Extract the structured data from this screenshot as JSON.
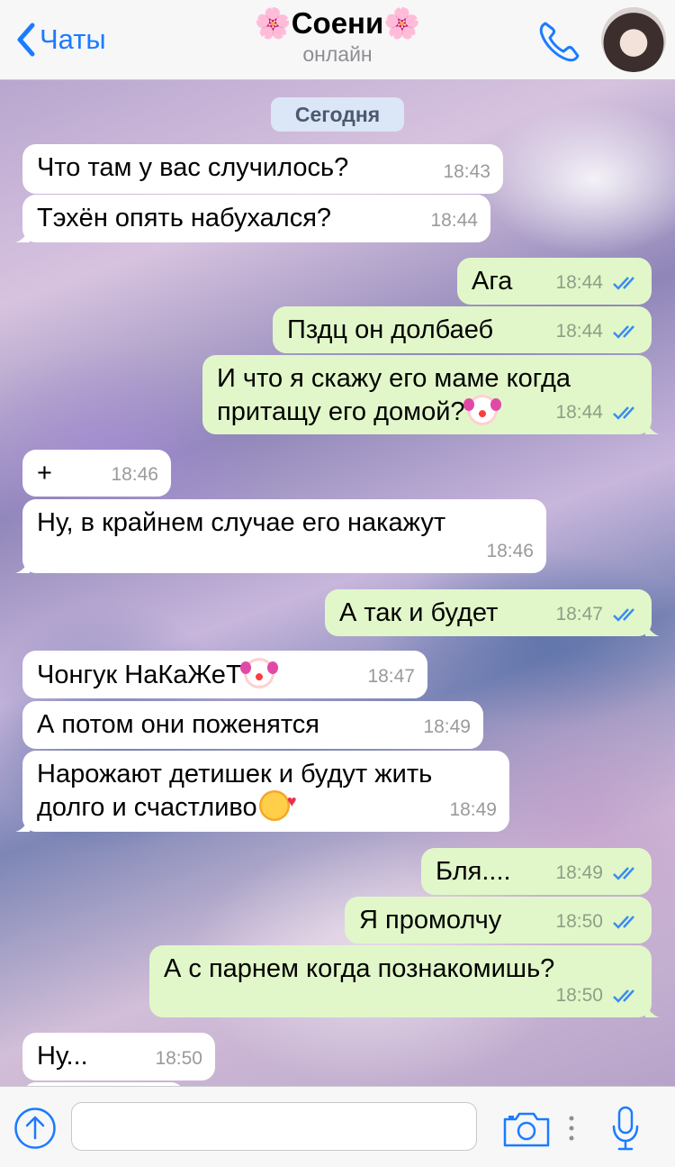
{
  "header": {
    "back_label": "Чаты",
    "title": "🌸Соени🌸",
    "subtitle": "онлайн"
  },
  "chat": {
    "date_label": "Сегодня",
    "messages": [
      {
        "dir": "in",
        "text": "Что там у вас случилось?",
        "time": "18:43"
      },
      {
        "dir": "in",
        "text": "Тэхён опять набухался?",
        "time": "18:44"
      },
      {
        "dir": "out",
        "text": "Ага",
        "time": "18:44"
      },
      {
        "dir": "out",
        "text": "Пздц он долбаеб",
        "time": "18:44"
      },
      {
        "dir": "out",
        "text": "И что я скажу его маме когда\nпритащу его домой?",
        "emoji": "clown-face",
        "time": "18:44"
      },
      {
        "dir": "in",
        "text": "+",
        "time": "18:46"
      },
      {
        "dir": "in",
        "text": "Ну, в крайнем случае его накажут",
        "time": "18:46"
      },
      {
        "dir": "out",
        "text": "А так и будет",
        "time": "18:47"
      },
      {
        "dir": "in",
        "text": "Чонгук НаКаЖеТ",
        "emoji": "clown-face",
        "time": "18:47"
      },
      {
        "dir": "in",
        "text": "А потом они поженятся",
        "time": "18:49"
      },
      {
        "dir": "in",
        "text": "Нарожают детишек и будут жить\nдолго и счастливо",
        "emoji": "smiling-face-with-hearts",
        "time": "18:49"
      },
      {
        "dir": "out",
        "text": "Бля....",
        "time": "18:49"
      },
      {
        "dir": "out",
        "text": "Я промолчу",
        "time": "18:50"
      },
      {
        "dir": "out",
        "text": "А с парнем когда познакомишь?",
        "time": "18:50"
      },
      {
        "dir": "in",
        "text": "Ну...",
        "time": "18:50"
      }
    ]
  },
  "input": {
    "value": "",
    "placeholder": ""
  },
  "colors": {
    "accent": "#1a7cff",
    "incoming_bubble": "#ffffff",
    "outgoing_bubble": "#e1f7c9",
    "read_ticks": "#3b8cf0"
  },
  "icons": [
    "chevron-left-icon",
    "phone-icon",
    "avatar",
    "attach-upload-icon",
    "camera-icon",
    "more-dots-icon",
    "microphone-icon",
    "double-check-icon"
  ]
}
